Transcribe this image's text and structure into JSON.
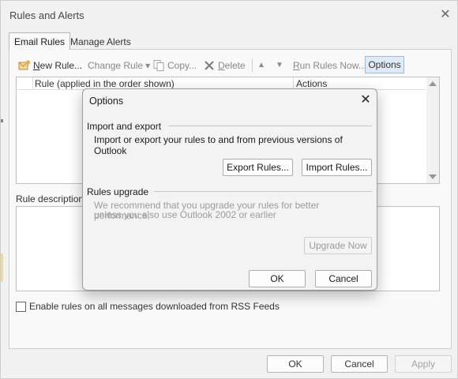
{
  "window": {
    "title": "Rules and Alerts",
    "close_glyph": "✕",
    "tabs": [
      {
        "label": "Email Rules",
        "active": true
      },
      {
        "label": "Manage Alerts",
        "active": false
      }
    ]
  },
  "toolbar": {
    "new_rule": {
      "prefix": "N",
      "rest": "ew Rule..."
    },
    "change_rule": {
      "prefix": "",
      "rest": "Change Rule",
      "caret": "▾"
    },
    "copy": {
      "prefix": "",
      "rest": "Copy..."
    },
    "delete": {
      "prefix": "D",
      "rest": "elete"
    },
    "move_up_glyph": "▲",
    "move_down_glyph": "▼",
    "run_rules": {
      "prefix": "R",
      "rest": "un Rules Now..."
    },
    "options": {
      "prefix": "",
      "rest": "Options"
    }
  },
  "rules_list": {
    "columns": [
      "Rule (applied in the order shown)",
      "Actions"
    ],
    "rows": []
  },
  "rule_description": {
    "label": "Rule description"
  },
  "rss": {
    "label": "Enable rules on all messages downloaded from RSS Feeds",
    "checked": false
  },
  "footer": {
    "ok": "OK",
    "cancel": "Cancel",
    "apply": "Apply"
  },
  "dialog": {
    "title": "Options",
    "close_glyph": "✕",
    "import_export": {
      "heading": "Import and export",
      "description": "Import or export your rules to and from previous versions of Outlook",
      "export_button": "Export Rules...",
      "import_button": "Import Rules..."
    },
    "upgrade": {
      "heading": "Rules upgrade",
      "line1": "We recommend that you upgrade your rules for better performance,",
      "line2": "unless you also use Outlook 2002 or earlier",
      "button": "Upgrade Now"
    },
    "ok": "OK",
    "cancel": "Cancel"
  },
  "colors": {
    "accent_border": "#8ab4e0",
    "accent_fill": "#dde9f6",
    "disabled_text": "#9c9c9c",
    "delete_icon": "#6b6b6b",
    "new_icon": "#e7a33a"
  }
}
